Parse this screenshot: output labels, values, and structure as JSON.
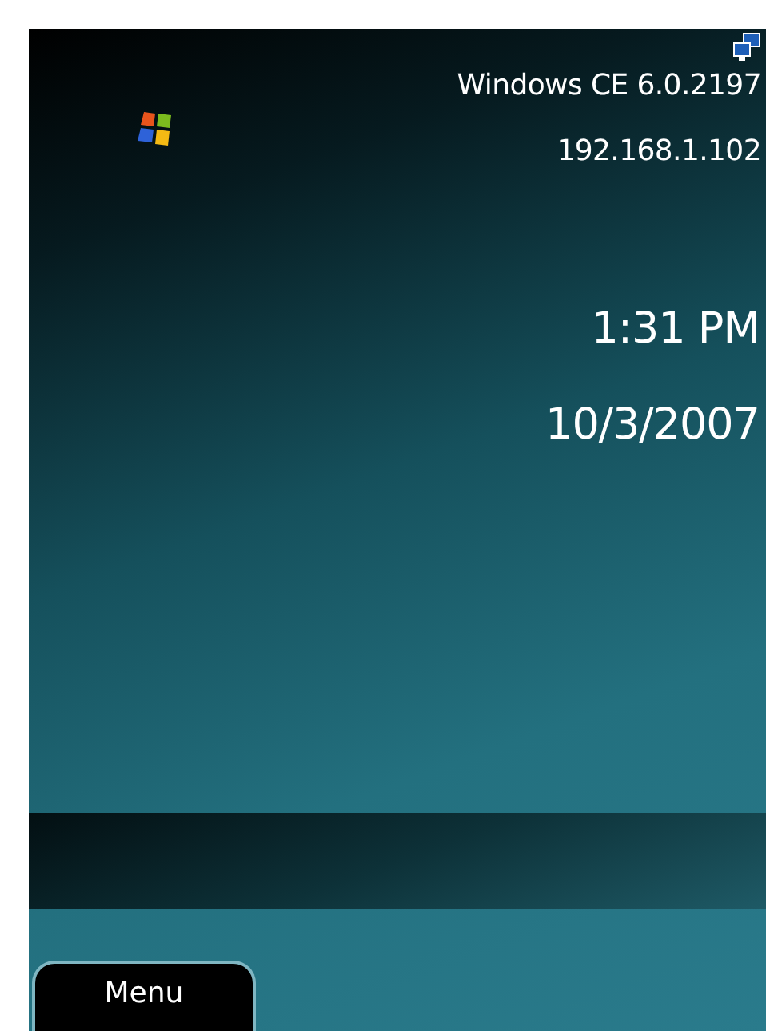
{
  "header": {
    "os_version": "Windows CE 6.0.2197",
    "ip_address": "192.168.1.102"
  },
  "clock": {
    "time": "1:31 PM",
    "date": "10/3/2007"
  },
  "softkeys": [
    {
      "label": "Menu"
    }
  ]
}
